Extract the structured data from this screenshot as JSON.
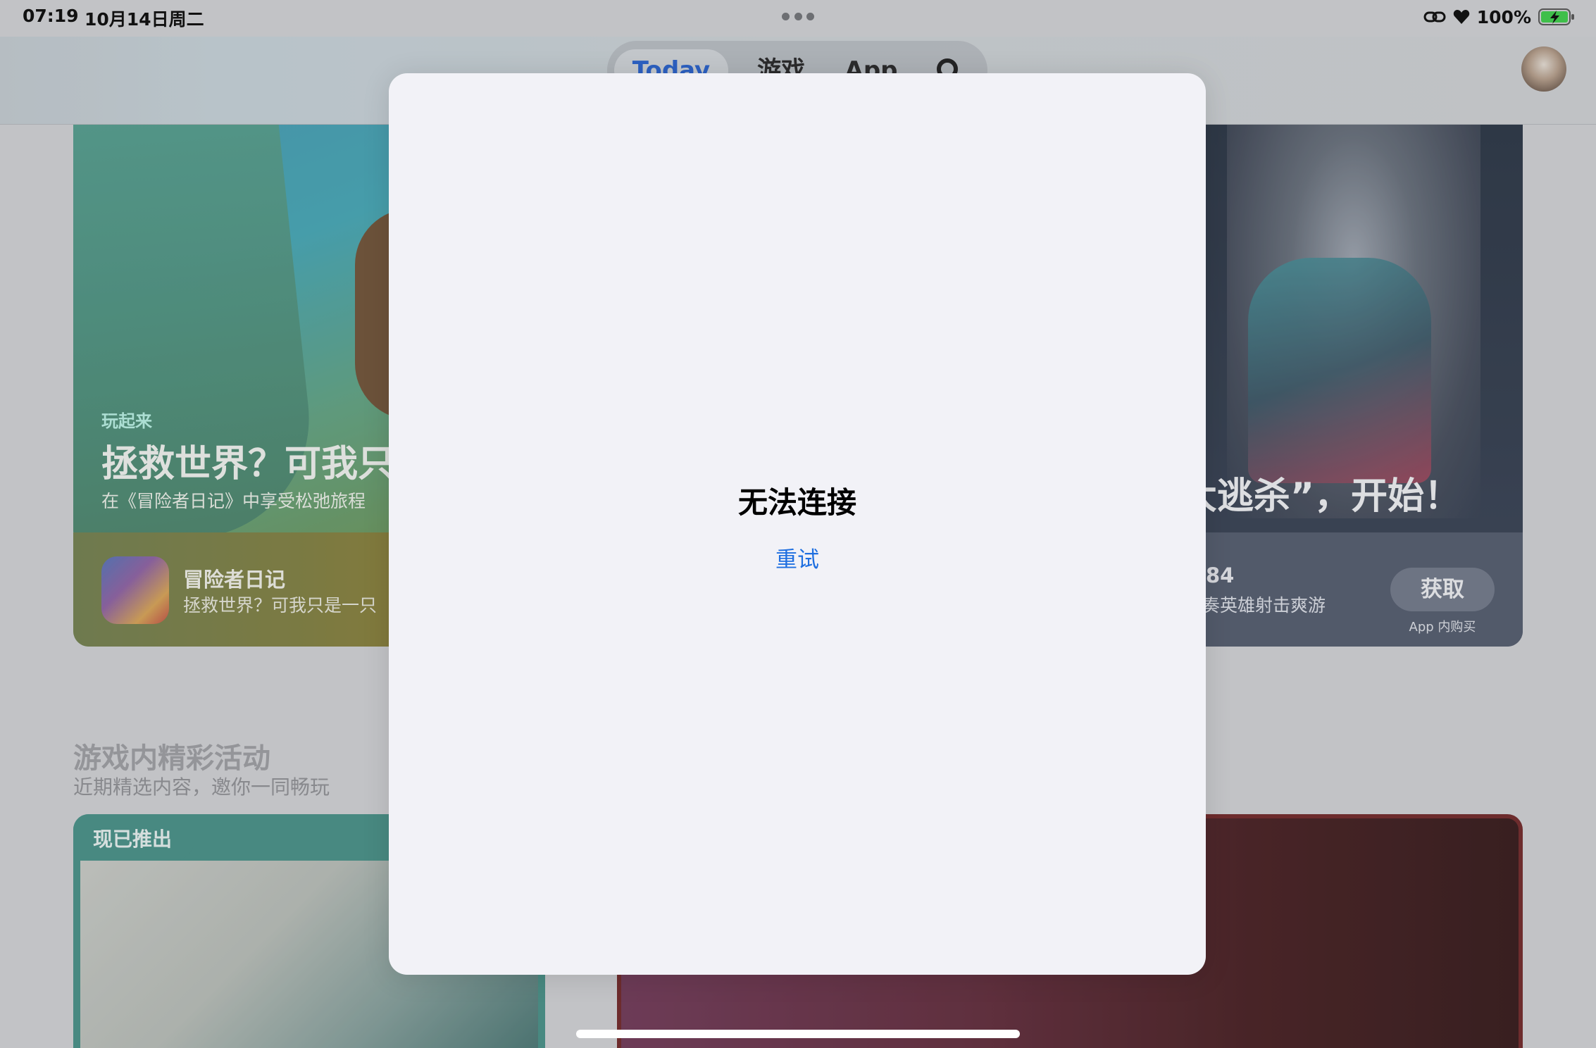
{
  "status_bar": {
    "time": "07:19",
    "date": "10月14日周二",
    "battery": "100%"
  },
  "nav": {
    "tabs": [
      {
        "label": "Today",
        "active": true
      },
      {
        "label": "游戏",
        "active": false
      },
      {
        "label": "App",
        "active": false
      }
    ],
    "accent_color": "#1b5bd0"
  },
  "featured_left": {
    "eyebrow": "玩起来",
    "title": "拯救世界？可我只",
    "subtitle": "在《冒险者日记》中享受松弛旅程",
    "app_name": "冒险者日记",
    "app_desc": "拯救世界？可我只是一只"
  },
  "featured_right": {
    "title": "大逃杀”，开始！",
    "app_name": "84",
    "app_desc": "奏英雄射击爽游",
    "get_label": "获取",
    "iap_note": "App 内购买"
  },
  "section": {
    "title": "游戏内精彩活动",
    "subtitle": "近期精选内容，邀你一同畅玩",
    "badge": "现已推出"
  },
  "modal": {
    "title": "无法连接",
    "retry_label": "重试",
    "link_color": "#1f6fe0"
  }
}
